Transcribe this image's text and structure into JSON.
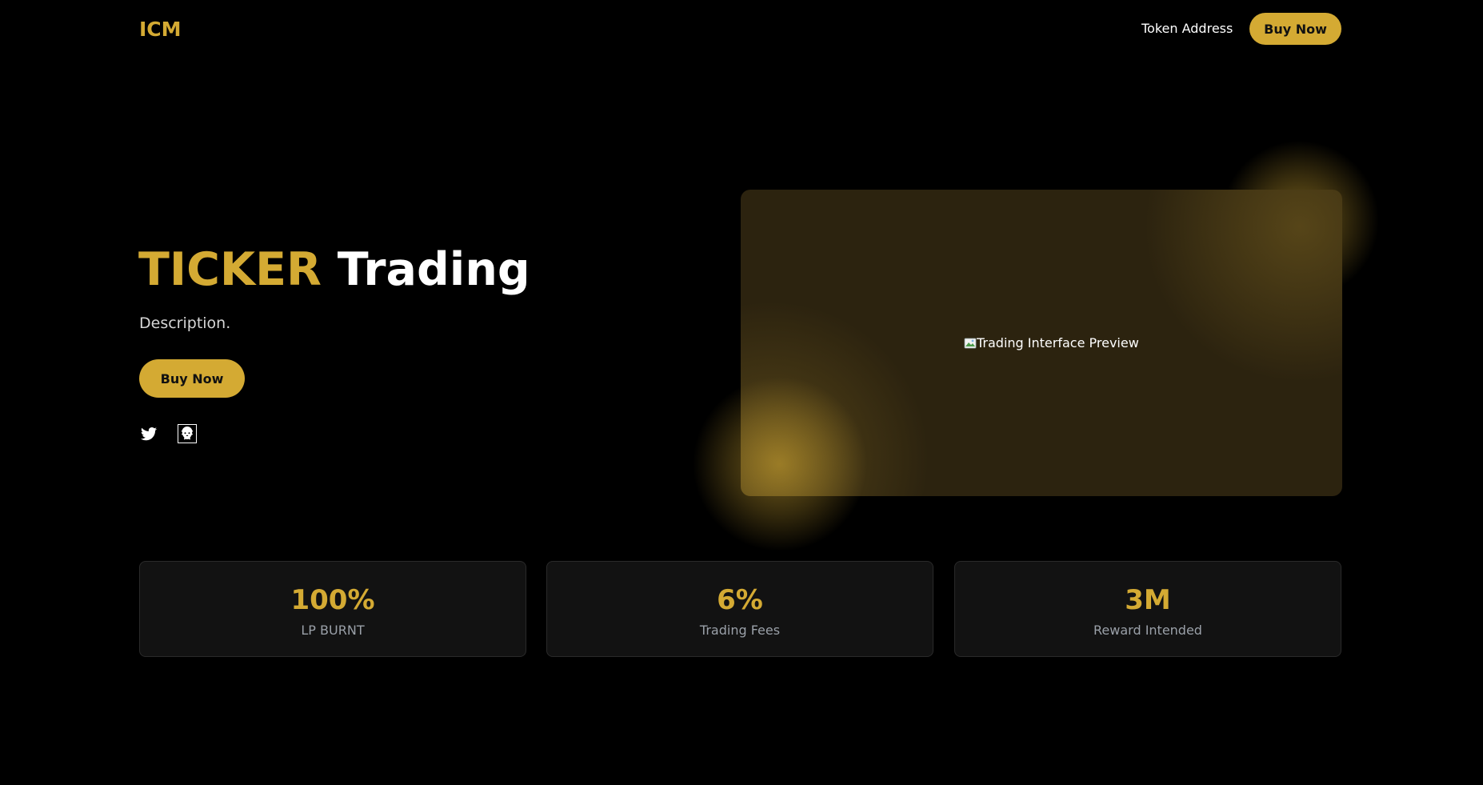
{
  "nav": {
    "logo": "ICM",
    "token_address_label": "Token Address",
    "buy_label": "Buy Now"
  },
  "hero": {
    "title_accent": "TICKER",
    "title_rest": "Trading",
    "description": "Description.",
    "buy_label": "Buy Now",
    "socials": [
      {
        "icon": "twitter-icon"
      },
      {
        "icon": "lion-logo-icon"
      }
    ]
  },
  "preview": {
    "image_alt": "Trading Interface Preview"
  },
  "stats": [
    {
      "value": "100%",
      "label": "LP BURNT"
    },
    {
      "value": "6%",
      "label": "Trading Fees"
    },
    {
      "value": "3M",
      "label": "Reward Intended"
    }
  ],
  "colors": {
    "accent": "#d4aa33",
    "background": "#000000",
    "card": "#121212",
    "preview_card": "#2c230f"
  }
}
